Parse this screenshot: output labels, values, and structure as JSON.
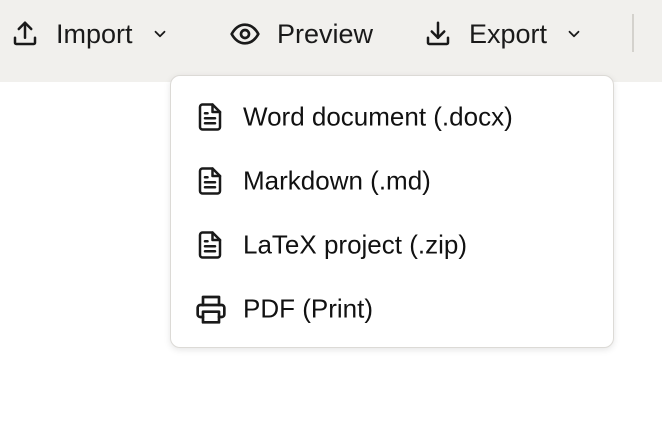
{
  "toolbar": {
    "import": {
      "label": "Import",
      "icon": "upload-icon"
    },
    "preview": {
      "label": "Preview",
      "icon": "eye-icon"
    },
    "export": {
      "label": "Export",
      "icon": "download-icon"
    }
  },
  "export_menu": {
    "items": [
      {
        "label": "Word document (.docx)",
        "icon": "document-icon"
      },
      {
        "label": "Markdown (.md)",
        "icon": "document-icon"
      },
      {
        "label": "LaTeX project (.zip)",
        "icon": "document-icon"
      },
      {
        "label": "PDF (Print)",
        "icon": "printer-icon"
      }
    ]
  },
  "colors": {
    "toolbar_bg": "#f1f0ed",
    "menu_bg": "#ffffff",
    "text": "#111111"
  }
}
